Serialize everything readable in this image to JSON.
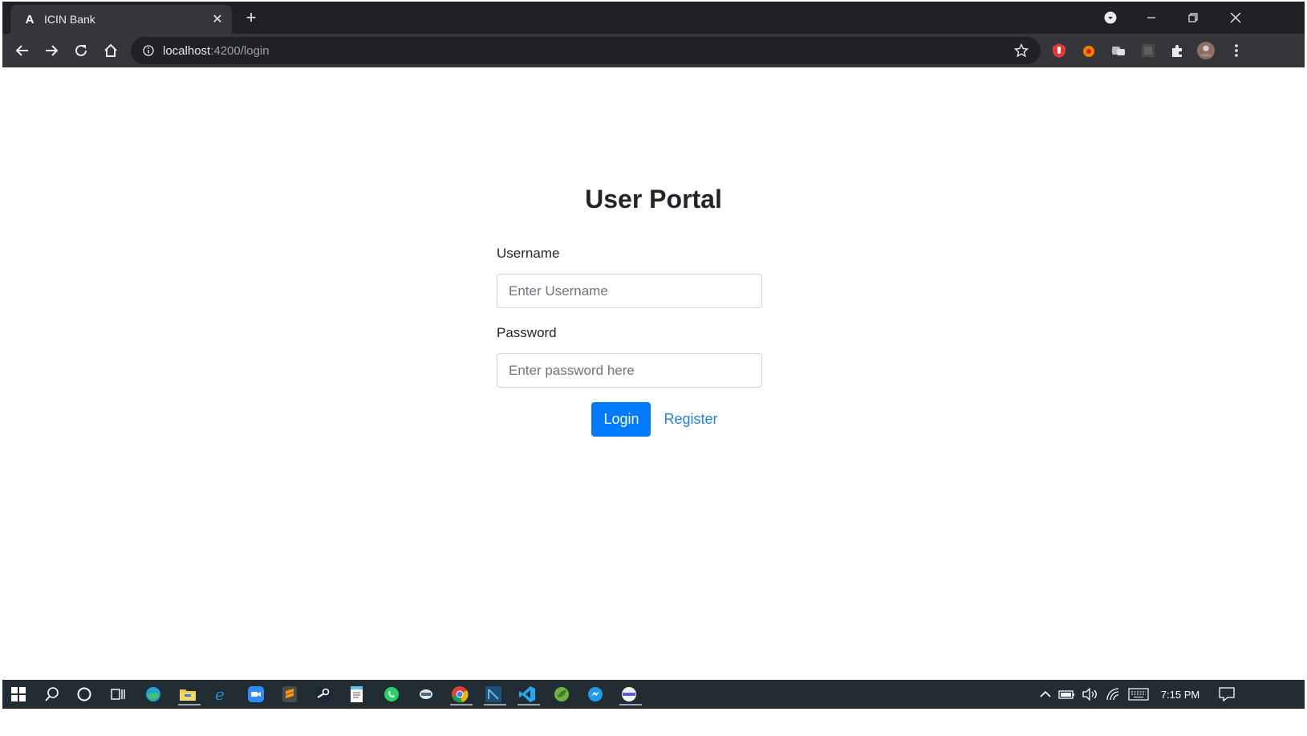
{
  "browser": {
    "tab_title": "ICIN Bank",
    "tab_favicon": "A",
    "url_host": "localhost",
    "url_path": ":4200/login"
  },
  "page": {
    "title": "User Portal",
    "username_label": "Username",
    "username_placeholder": "Enter Username",
    "password_label": "Password",
    "password_placeholder": "Enter password here",
    "login_button": "Login",
    "register_link": "Register"
  },
  "taskbar": {
    "clock": "7:15 PM"
  },
  "colors": {
    "primary": "#007bff",
    "link": "#1e7ff0",
    "chrome_dark": "#202124",
    "chrome_toolbar": "#35363a",
    "taskbar": "#222c33"
  }
}
